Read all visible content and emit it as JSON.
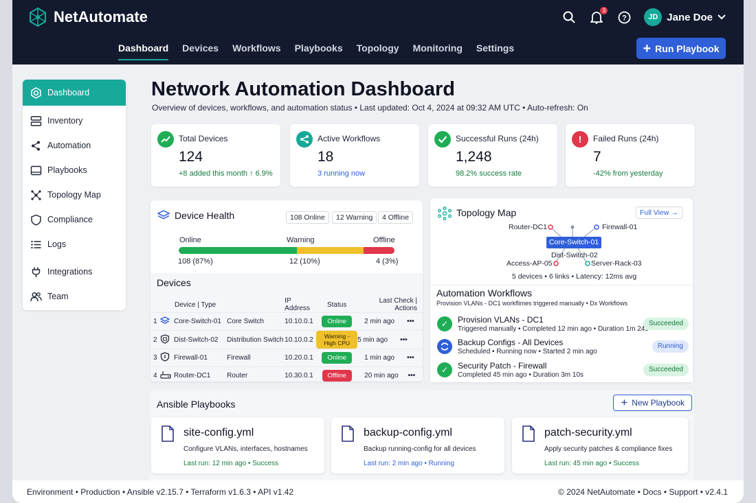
{
  "app": {
    "name": "NetAutomate"
  },
  "header": {
    "notifications_count": "3",
    "user": {
      "initials": "JD",
      "name": "Jane Doe"
    },
    "nav": [
      "Dashboard",
      "Devices",
      "Workflows",
      "Playbooks",
      "Topology",
      "Monitoring",
      "Settings"
    ],
    "run_button": "Run Playbook"
  },
  "sidebar": {
    "items": [
      "Dashboard",
      "Inventory",
      "Automation",
      "Playbooks",
      "Topology Map",
      "Compliance",
      "Logs",
      "Integrations",
      "Team"
    ]
  },
  "page": {
    "title": "Network Automation Dashboard",
    "subtitle": "Overview of devices, workflows, and automation status • Last updated: Oct 4, 2024 at 09:32 AM UTC • Auto-refresh: On"
  },
  "stats": [
    {
      "label": "Total Devices",
      "value": "124",
      "note": "+8 added this month ↑ 6.9%",
      "color": "#1fae56"
    },
    {
      "label": "Active Workflows",
      "value": "18",
      "note": "3 running now",
      "color": "#17a99a"
    },
    {
      "label": "Successful Runs (24h)",
      "value": "1,248",
      "note": "98.2% success rate",
      "color": "#1fae56"
    },
    {
      "label": "Failed Runs (24h)",
      "value": "7",
      "note": "-42% from yesterday",
      "color": "#e0374b"
    }
  ],
  "health": {
    "title": "Device Health",
    "pills": [
      "108 Online",
      "12 Warning",
      "4 Offline"
    ],
    "online_label": "Online",
    "warning_label": "Warning",
    "offline_label": "Offline",
    "online_value": "108 (87%)",
    "warning_value": "12 (10%)",
    "offline_value": "4 (3%)",
    "online_pct": 87,
    "warning_pct": 10,
    "offline_pct": 3
  },
  "devices": {
    "title": "Devices",
    "columns": {
      "device_type": "Device  |  Type",
      "ip": "IP Address",
      "status": "Status",
      "last_actions": "Last Check | Actions"
    },
    "rows": [
      {
        "num": "1",
        "name": "Core-Switch-01",
        "type": "Core Switch",
        "ip": "10.10.0.1",
        "status": "Online",
        "status_kind": "on",
        "last": "2 min ago",
        "icon": "switch-icon"
      },
      {
        "num": "2",
        "name": "Dist-Switch-02",
        "type": "Distribution Switch",
        "ip": "10.10.0.2",
        "status": "Warning - High CPU",
        "status_kind": "warn",
        "last": "5 min ago",
        "icon": "shield-switch-icon"
      },
      {
        "num": "3",
        "name": "Firewall-01",
        "type": "Firewall",
        "ip": "10.20.0.1",
        "status": "Online",
        "status_kind": "on",
        "last": "1 min ago",
        "icon": "firewall-icon"
      },
      {
        "num": "4",
        "name": "Router-DC1",
        "type": "Router",
        "ip": "10.30.0.1",
        "status": "Offline",
        "status_kind": "off",
        "last": "20 min ago",
        "icon": "router-icon"
      }
    ],
    "actions_glyph": "•••"
  },
  "topology": {
    "title": "Topology Map",
    "full_view": "Full View →",
    "nodes": {
      "router": "Router-DC1",
      "firewall": "Firewall-01",
      "core": "Core-Switch-01",
      "dist": "Dist-Switch-02",
      "access": "Access-AP-05",
      "server": "Server-Rack-03"
    },
    "summary": "5 devices  •  6 links  •  Latency: 12ms avg"
  },
  "workflows": {
    "title": "Automation Workflows",
    "subtitle": "Provision VLANs - DC1    workflimes triggered manually  •  Dx Workflows",
    "items": [
      {
        "name": "Provision VLANs - DC1",
        "meta": "Triggered manually • Completed 12 min ago • Duration 1m 24s",
        "status": "Succeeded",
        "kind": "succ"
      },
      {
        "name": "Backup Configs - All Devices",
        "meta": "Scheduled • Running now • Started 2 min ago",
        "status": "Running",
        "kind": "run"
      },
      {
        "name": "Security Patch - Firewall",
        "meta": "Completed 45 min ago • Duration 3m 10s",
        "status": "Succeeded",
        "kind": "succ"
      }
    ]
  },
  "playbooks": {
    "title": "Ansible Playbooks",
    "new_button": "New Playbook",
    "items": [
      {
        "name": "site-config.yml",
        "desc": "Configure VLANs, interfaces, hostnames",
        "last": "Last run: 12 min ago  •  Success"
      },
      {
        "name": "backup-config.yml",
        "desc": "Backup running-config for all devices",
        "last": "Last run: 2 min ago  •  Running"
      },
      {
        "name": "patch-security.yml",
        "desc": "Apply security patches & compliance fixes",
        "last": "Last run: 45 min ago  •  Success"
      }
    ]
  },
  "footer": {
    "left": "Environment  •  Production  •  Ansible v2.15.7  •  Terraform v1.6.3  •  API v1.42",
    "right": "© 2024 NetAutomate  •  Docs  •  Support  •  v2.4.1"
  }
}
